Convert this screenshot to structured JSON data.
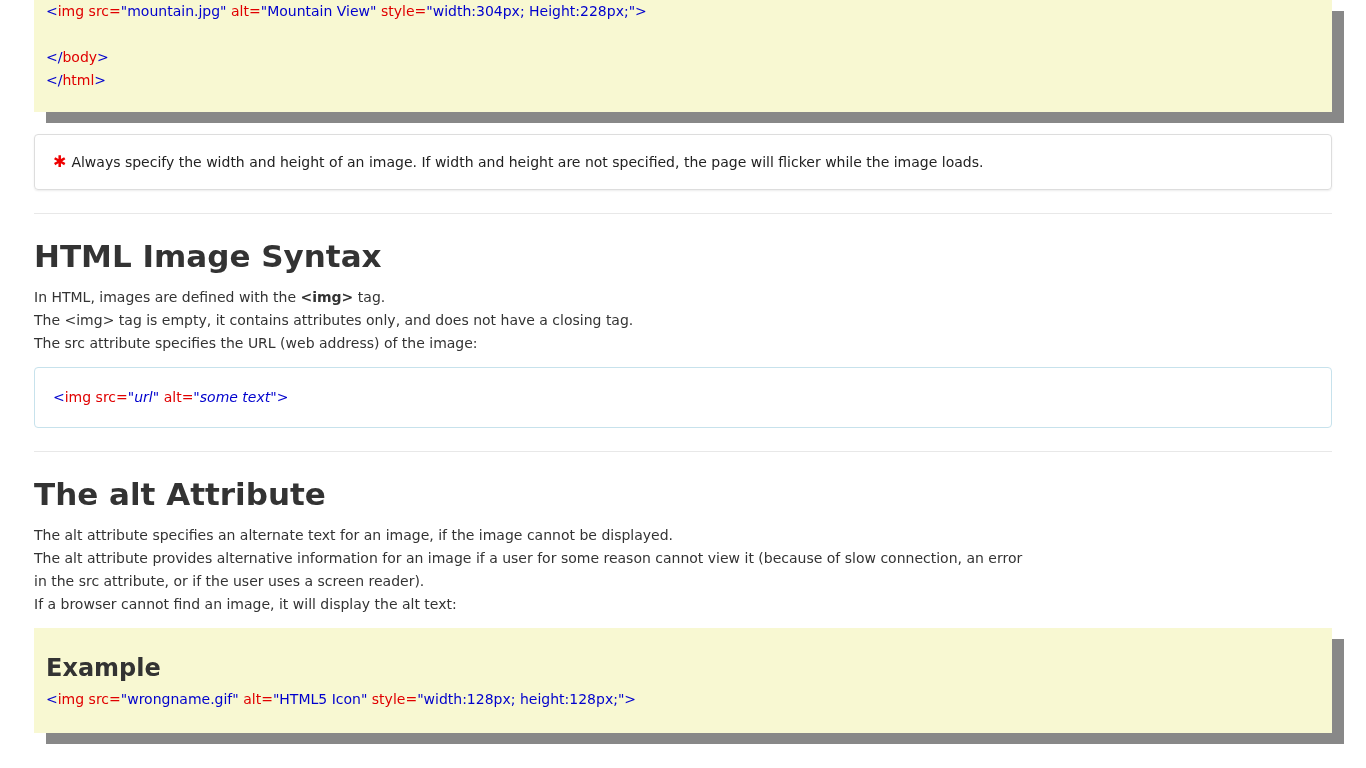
{
  "top_example": {
    "lines": [
      {
        "kind": "code",
        "tokens": [
          {
            "kind": "punct",
            "text": "<"
          },
          {
            "kind": "name",
            "text": "img src="
          },
          {
            "kind": "value",
            "text": "\"mountain.jpg\""
          },
          {
            "kind": "name",
            "text": " alt="
          },
          {
            "kind": "value",
            "text": "\"Mountain View\""
          },
          {
            "kind": "name",
            "text": " style="
          },
          {
            "kind": "value",
            "text": "\"width:304px; Height:228px;\""
          },
          {
            "kind": "punct",
            "text": ">"
          }
        ]
      },
      {
        "kind": "blank"
      },
      {
        "kind": "code",
        "tokens": [
          {
            "kind": "punct",
            "text": "</"
          },
          {
            "kind": "name",
            "text": "body"
          },
          {
            "kind": "punct",
            "text": ">"
          }
        ]
      },
      {
        "kind": "code",
        "tokens": [
          {
            "kind": "punct",
            "text": "</"
          },
          {
            "kind": "name",
            "text": "html"
          },
          {
            "kind": "punct",
            "text": ">"
          }
        ]
      }
    ]
  },
  "note": {
    "icon": "✱",
    "text": "Always specify the width and height of an image. If width and height are not specified, the page will flicker while the image loads."
  },
  "sections": [
    {
      "heading": "HTML Image Syntax",
      "paragraphs": [
        "In HTML, images are defined with the **<img>** tag.",
        "The <img> tag is empty, it contains attributes only, and does not have a closing tag.",
        "The src attribute specifies the URL (web address) of the image:"
      ],
      "block": {
        "kind": "syntax",
        "tokens": [
          {
            "kind": "punct",
            "text": "<"
          },
          {
            "kind": "name",
            "text": "img src="
          },
          {
            "kind": "value",
            "text": "\"*url*\""
          },
          {
            "kind": "name",
            "text": " alt="
          },
          {
            "kind": "value",
            "text": "\"*some text*\""
          },
          {
            "kind": "punct",
            "text": ">"
          }
        ]
      }
    },
    {
      "heading": "The alt Attribute",
      "paragraphs": [
        "The alt attribute specifies an alternate text for an image, if the image cannot be displayed.",
        "The alt attribute provides alternative information for an image if a user for some reason cannot view it (because of slow connection, an error in the src attribute, or if the user uses a screen reader).",
        "If a browser cannot find an image, it will display the alt text:"
      ],
      "block": {
        "kind": "example",
        "title": "Example",
        "tokens": [
          {
            "kind": "punct",
            "text": "<"
          },
          {
            "kind": "name",
            "text": "img src="
          },
          {
            "kind": "value",
            "text": "\"wrongname.gif\""
          },
          {
            "kind": "name",
            "text": " alt="
          },
          {
            "kind": "value",
            "text": "\"HTML5 Icon\""
          },
          {
            "kind": "name",
            "text": " style="
          },
          {
            "kind": "value",
            "text": "\"width:128px; height:128px;\""
          },
          {
            "kind": "punct",
            "text": ">"
          }
        ]
      }
    }
  ]
}
